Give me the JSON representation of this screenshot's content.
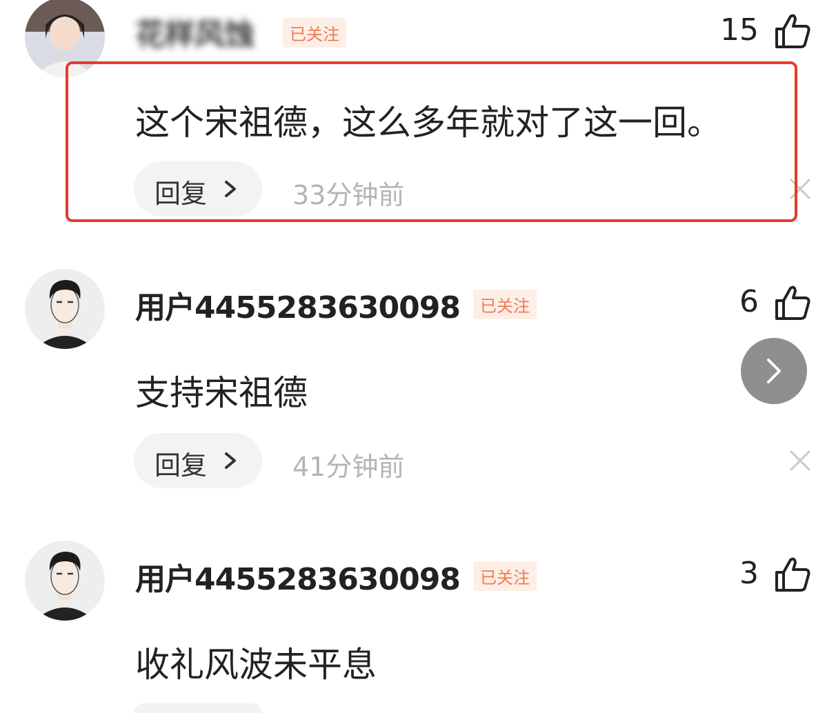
{
  "comments": [
    {
      "username": "花样风蚀",
      "follow_badge": "已关注",
      "likes": "15",
      "text": "这个宋祖德，这么多年就对了这一回。",
      "reply_label": "回复",
      "timestamp": "33分钟前"
    },
    {
      "username": "用户4455283630098",
      "follow_badge": "已关注",
      "likes": "6",
      "text": "支持宋祖德",
      "reply_label": "回复",
      "timestamp": "41分钟前"
    },
    {
      "username": "用户4455283630098",
      "follow_badge": "已关注",
      "likes": "3",
      "text": "收礼风波未平息"
    }
  ],
  "icons": {
    "like": "thumbs-up-icon",
    "close": "close-icon",
    "next": "chevron-right-icon",
    "reply_chevron": "chevron-right-icon"
  },
  "colors": {
    "highlight_border": "#e8392b",
    "follow_badge_text": "#f07a4f",
    "follow_badge_bg": "#fdeee6",
    "timestamp": "#b4b4b4",
    "next_button_bg": "#8f8f8f"
  }
}
